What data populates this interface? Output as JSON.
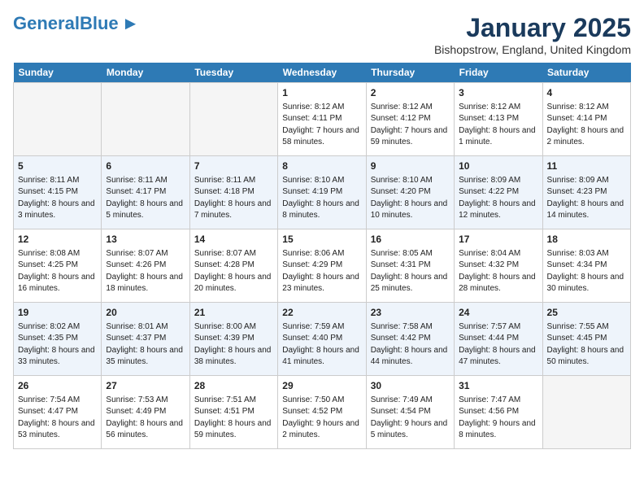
{
  "header": {
    "logo_general": "General",
    "logo_blue": "Blue",
    "month": "January 2025",
    "location": "Bishopstrow, England, United Kingdom"
  },
  "weekdays": [
    "Sunday",
    "Monday",
    "Tuesday",
    "Wednesday",
    "Thursday",
    "Friday",
    "Saturday"
  ],
  "weeks": [
    [
      {
        "day": "",
        "info": ""
      },
      {
        "day": "",
        "info": ""
      },
      {
        "day": "",
        "info": ""
      },
      {
        "day": "1",
        "info": "Sunrise: 8:12 AM\nSunset: 4:11 PM\nDaylight: 7 hours and 58 minutes."
      },
      {
        "day": "2",
        "info": "Sunrise: 8:12 AM\nSunset: 4:12 PM\nDaylight: 7 hours and 59 minutes."
      },
      {
        "day": "3",
        "info": "Sunrise: 8:12 AM\nSunset: 4:13 PM\nDaylight: 8 hours and 1 minute."
      },
      {
        "day": "4",
        "info": "Sunrise: 8:12 AM\nSunset: 4:14 PM\nDaylight: 8 hours and 2 minutes."
      }
    ],
    [
      {
        "day": "5",
        "info": "Sunrise: 8:11 AM\nSunset: 4:15 PM\nDaylight: 8 hours and 3 minutes."
      },
      {
        "day": "6",
        "info": "Sunrise: 8:11 AM\nSunset: 4:17 PM\nDaylight: 8 hours and 5 minutes."
      },
      {
        "day": "7",
        "info": "Sunrise: 8:11 AM\nSunset: 4:18 PM\nDaylight: 8 hours and 7 minutes."
      },
      {
        "day": "8",
        "info": "Sunrise: 8:10 AM\nSunset: 4:19 PM\nDaylight: 8 hours and 8 minutes."
      },
      {
        "day": "9",
        "info": "Sunrise: 8:10 AM\nSunset: 4:20 PM\nDaylight: 8 hours and 10 minutes."
      },
      {
        "day": "10",
        "info": "Sunrise: 8:09 AM\nSunset: 4:22 PM\nDaylight: 8 hours and 12 minutes."
      },
      {
        "day": "11",
        "info": "Sunrise: 8:09 AM\nSunset: 4:23 PM\nDaylight: 8 hours and 14 minutes."
      }
    ],
    [
      {
        "day": "12",
        "info": "Sunrise: 8:08 AM\nSunset: 4:25 PM\nDaylight: 8 hours and 16 minutes."
      },
      {
        "day": "13",
        "info": "Sunrise: 8:07 AM\nSunset: 4:26 PM\nDaylight: 8 hours and 18 minutes."
      },
      {
        "day": "14",
        "info": "Sunrise: 8:07 AM\nSunset: 4:28 PM\nDaylight: 8 hours and 20 minutes."
      },
      {
        "day": "15",
        "info": "Sunrise: 8:06 AM\nSunset: 4:29 PM\nDaylight: 8 hours and 23 minutes."
      },
      {
        "day": "16",
        "info": "Sunrise: 8:05 AM\nSunset: 4:31 PM\nDaylight: 8 hours and 25 minutes."
      },
      {
        "day": "17",
        "info": "Sunrise: 8:04 AM\nSunset: 4:32 PM\nDaylight: 8 hours and 28 minutes."
      },
      {
        "day": "18",
        "info": "Sunrise: 8:03 AM\nSunset: 4:34 PM\nDaylight: 8 hours and 30 minutes."
      }
    ],
    [
      {
        "day": "19",
        "info": "Sunrise: 8:02 AM\nSunset: 4:35 PM\nDaylight: 8 hours and 33 minutes."
      },
      {
        "day": "20",
        "info": "Sunrise: 8:01 AM\nSunset: 4:37 PM\nDaylight: 8 hours and 35 minutes."
      },
      {
        "day": "21",
        "info": "Sunrise: 8:00 AM\nSunset: 4:39 PM\nDaylight: 8 hours and 38 minutes."
      },
      {
        "day": "22",
        "info": "Sunrise: 7:59 AM\nSunset: 4:40 PM\nDaylight: 8 hours and 41 minutes."
      },
      {
        "day": "23",
        "info": "Sunrise: 7:58 AM\nSunset: 4:42 PM\nDaylight: 8 hours and 44 minutes."
      },
      {
        "day": "24",
        "info": "Sunrise: 7:57 AM\nSunset: 4:44 PM\nDaylight: 8 hours and 47 minutes."
      },
      {
        "day": "25",
        "info": "Sunrise: 7:55 AM\nSunset: 4:45 PM\nDaylight: 8 hours and 50 minutes."
      }
    ],
    [
      {
        "day": "26",
        "info": "Sunrise: 7:54 AM\nSunset: 4:47 PM\nDaylight: 8 hours and 53 minutes."
      },
      {
        "day": "27",
        "info": "Sunrise: 7:53 AM\nSunset: 4:49 PM\nDaylight: 8 hours and 56 minutes."
      },
      {
        "day": "28",
        "info": "Sunrise: 7:51 AM\nSunset: 4:51 PM\nDaylight: 8 hours and 59 minutes."
      },
      {
        "day": "29",
        "info": "Sunrise: 7:50 AM\nSunset: 4:52 PM\nDaylight: 9 hours and 2 minutes."
      },
      {
        "day": "30",
        "info": "Sunrise: 7:49 AM\nSunset: 4:54 PM\nDaylight: 9 hours and 5 minutes."
      },
      {
        "day": "31",
        "info": "Sunrise: 7:47 AM\nSunset: 4:56 PM\nDaylight: 9 hours and 8 minutes."
      },
      {
        "day": "",
        "info": ""
      }
    ]
  ]
}
